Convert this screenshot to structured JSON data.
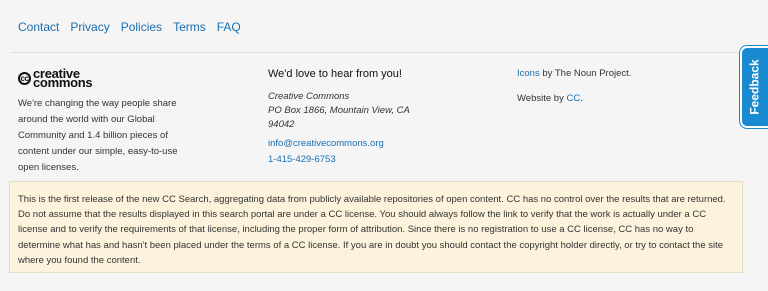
{
  "nav": {
    "links": [
      "Contact",
      "Privacy",
      "Policies",
      "Terms",
      "FAQ"
    ]
  },
  "logo": {
    "symbol": "cc",
    "line1": "creative",
    "line2": "commons"
  },
  "about": "We're changing the way people share around the world with our Global Community and 1.4 billion pieces of content under our simple, easy-to-use open licenses.",
  "contact": {
    "heading": "We'd love to hear from you!",
    "org": "Creative Commons",
    "address1": "PO Box 1866, Mountain View, CA",
    "zip": "94042",
    "email": "info@creativecommons.org",
    "phone": "1-415-429-6753"
  },
  "credits": {
    "icons_link": "Icons",
    "icons_text": " by The Noun Project.",
    "website_text": "Website by ",
    "website_link": "CC",
    "website_end": "."
  },
  "feedback_label": "Feedback",
  "notice": "This is the first release of the new CC Search, aggregating data from publicly available repositories of open content. CC has no control over the results that are returned. Do not assume that the results displayed in this search portal are under a CC license. You should always follow the link to verify that the work is actually under a CC license and to verify the requirements of that license, including the proper form of attribution. Since there is no registration to use a CC license, CC has no way to determine what has and hasn't been placed under the terms of a CC license. If you are in doubt you should contact the copyright holder directly, or try to contact the site where you found the content.",
  "colors": {
    "link": "#1a6fb0",
    "feedback": "#1a8ad0",
    "notice_bg": "#fdf3dc"
  }
}
